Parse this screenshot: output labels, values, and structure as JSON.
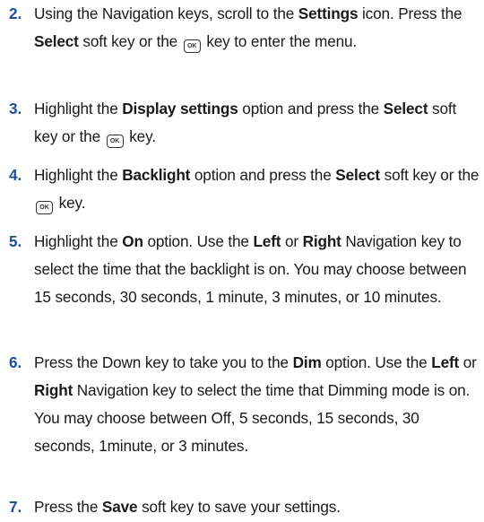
{
  "steps": [
    {
      "num": "2.",
      "parts": [
        {
          "t": "Using the Navigation keys, scroll to the "
        },
        {
          "t": "Settings",
          "b": true
        },
        {
          "t": " icon. Press the "
        },
        {
          "t": "Select",
          "b": true
        },
        {
          "t": " soft key or the "
        },
        {
          "icon": "ok-key-icon",
          "label": "OK"
        },
        {
          "t": " key to enter the menu."
        }
      ]
    },
    {
      "num": "3.",
      "parts": [
        {
          "t": "Highlight the "
        },
        {
          "t": "Display settings",
          "b": true
        },
        {
          "t": " option and press the "
        },
        {
          "t": "Select",
          "b": true
        },
        {
          "t": " soft key or the "
        },
        {
          "icon": "ok-key-icon",
          "label": "OK"
        },
        {
          "t": " key."
        }
      ]
    },
    {
      "num": "4.",
      "parts": [
        {
          "t": "Highlight the "
        },
        {
          "t": "Backlight",
          "b": true
        },
        {
          "t": " option and press the "
        },
        {
          "t": "Select",
          "b": true
        },
        {
          "t": " soft key or the "
        },
        {
          "icon": "ok-key-icon",
          "label": "OK"
        },
        {
          "t": " key."
        }
      ]
    },
    {
      "num": "5.",
      "parts": [
        {
          "t": "Highlight the "
        },
        {
          "t": "On",
          "b": true
        },
        {
          "t": " option. Use the "
        },
        {
          "t": "Left",
          "b": true
        },
        {
          "t": " or "
        },
        {
          "t": "Right",
          "b": true
        },
        {
          "t": " Navigation key to select the time that the backlight is on. You may choose between 15 seconds, 30 seconds, 1 minute, 3 minutes, or 10 minutes."
        }
      ]
    },
    {
      "num": "6.",
      "parts": [
        {
          "t": "Press the Down key to take you to the "
        },
        {
          "t": "Dim",
          "b": true
        },
        {
          "t": " option. Use the "
        },
        {
          "t": "Left",
          "b": true
        },
        {
          "t": " or "
        },
        {
          "t": "Right",
          "b": true
        },
        {
          "t": " Navigation key to select the time that Dimming mode is on. You may choose between Off, 5 seconds, 15 seconds, 30 seconds, 1minute, or 3 minutes."
        }
      ]
    },
    {
      "num": "7.",
      "parts": [
        {
          "t": "Press the "
        },
        {
          "t": "Save",
          "b": true
        },
        {
          "t": " soft key to save your settings."
        }
      ]
    }
  ]
}
